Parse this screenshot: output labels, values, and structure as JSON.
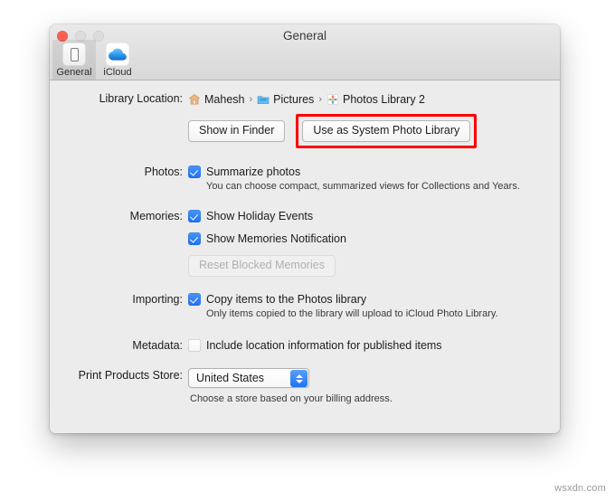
{
  "window": {
    "title": "General",
    "traffic_lights": [
      "close",
      "minimize",
      "zoom"
    ]
  },
  "toolbar": {
    "tabs": [
      {
        "label": "General",
        "icon": "device-icon",
        "selected": true
      },
      {
        "label": "iCloud",
        "icon": "cloud-icon",
        "selected": false
      }
    ]
  },
  "settings": {
    "library_location": {
      "label": "Library Location:",
      "breadcrumb": [
        {
          "text": "Mahesh",
          "icon": "home-icon"
        },
        {
          "text": "Pictures",
          "icon": "folder-icon"
        },
        {
          "text": "Photos Library 2",
          "icon": "photos-library-icon"
        }
      ],
      "separator": "›",
      "show_in_finder_label": "Show in Finder",
      "use_as_system_label": "Use as System Photo Library",
      "highlight_color": "#fe0000"
    },
    "photos": {
      "label": "Photos:",
      "summarize_label": "Summarize photos",
      "summarize_checked": true,
      "summarize_helper": "You can choose compact, summarized views for Collections and Years."
    },
    "memories": {
      "label": "Memories:",
      "holiday_label": "Show Holiday Events",
      "holiday_checked": true,
      "notification_label": "Show Memories Notification",
      "notification_checked": true,
      "reset_button_label": "Reset Blocked Memories",
      "reset_button_disabled": true
    },
    "importing": {
      "label": "Importing:",
      "copy_label": "Copy items to the Photos library",
      "copy_checked": true,
      "copy_helper": "Only items copied to the library will upload to iCloud Photo Library."
    },
    "metadata": {
      "label": "Metadata:",
      "include_location_label": "Include location information for published items",
      "include_location_checked": false
    },
    "print_products_store": {
      "label": "Print Products Store:",
      "selected_value": "United States",
      "helper": "Choose a store based on your billing address.",
      "accent_color": "#1f72f3"
    }
  },
  "watermark": "wsxdn.com"
}
